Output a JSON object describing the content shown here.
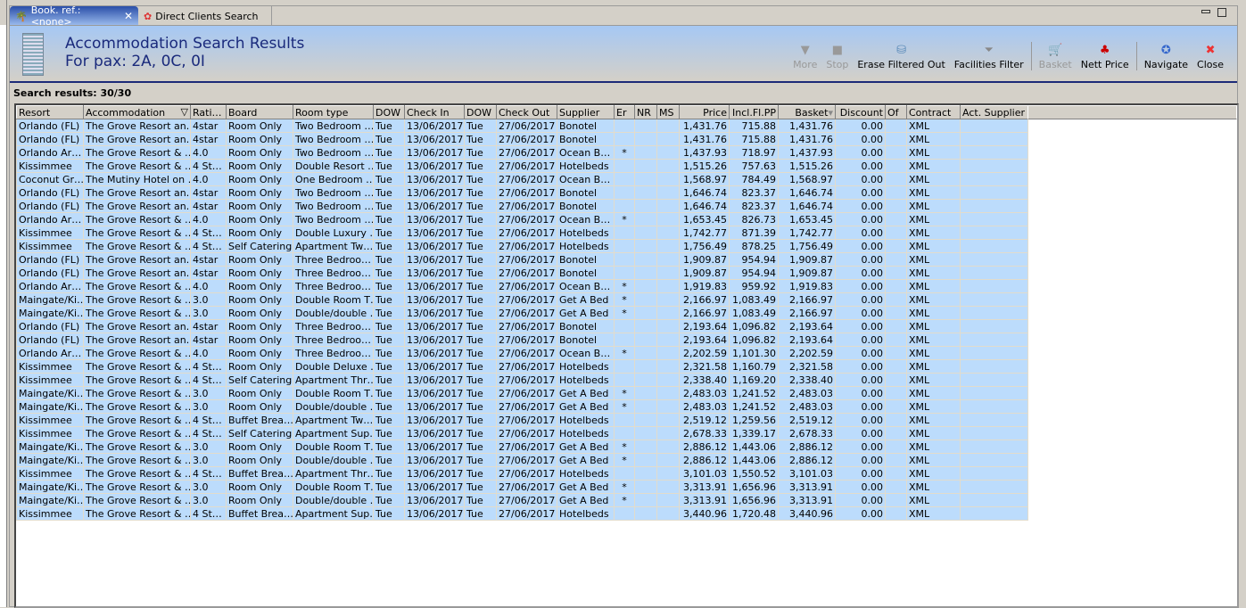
{
  "tabs": [
    {
      "label": "Book. ref.: <none>",
      "icon": "palm-island-icon",
      "active": true
    },
    {
      "label": "Direct Clients Search",
      "icon": "client-icon",
      "active": false
    }
  ],
  "header": {
    "title": "Accommodation Search Results",
    "subtitle": "For pax: 2A, 0C, 0I"
  },
  "toolbar": [
    {
      "label": "More",
      "icon": "triangle-down-icon",
      "enabled": false
    },
    {
      "label": "Stop",
      "icon": "stop-icon",
      "enabled": false
    },
    {
      "label": "Erase Filtered Out",
      "icon": "erase-bin-icon",
      "enabled": true
    },
    {
      "label": "Facilities Filter",
      "icon": "funnel-icon",
      "enabled": true
    },
    {
      "label": "Basket",
      "icon": "cart-icon",
      "enabled": false
    },
    {
      "label": "Nett Price",
      "icon": "nett-price-icon",
      "enabled": true
    },
    {
      "label": "Navigate",
      "icon": "compass-icon",
      "enabled": true
    },
    {
      "label": "Close",
      "icon": "close-icon",
      "enabled": true
    }
  ],
  "results_label": "Search results: 30/30",
  "columns": [
    "Resort",
    "Accommodation",
    "Rati…",
    "Board",
    "Room type",
    "DOW",
    "Check In",
    "DOW",
    "Check Out",
    "Supplier",
    "Er",
    "NR",
    "MS",
    "Price",
    "Incl.Fl.PP",
    "Basket",
    "Discount",
    "Of",
    "Contract",
    "Act. Supplier"
  ],
  "rows": [
    [
      "Orlando (FL)",
      "The Grove Resort an…",
      "4star",
      "Room Only",
      "Two Bedroom …",
      "Tue",
      "13/06/2017",
      "Tue",
      "27/06/2017",
      "Bonotel",
      "",
      "",
      "",
      "1,431.76",
      "715.88",
      "1,431.76",
      "0.00",
      "",
      "XML",
      ""
    ],
    [
      "Orlando (FL)",
      "The Grove Resort an…",
      "4star",
      "Room Only",
      "Two Bedroom …",
      "Tue",
      "13/06/2017",
      "Tue",
      "27/06/2017",
      "Bonotel",
      "",
      "",
      "",
      "1,431.76",
      "715.88",
      "1,431.76",
      "0.00",
      "",
      "XML",
      ""
    ],
    [
      "Orlando Ar…",
      "The Grove Resort & …",
      "4.0",
      "Room Only",
      "Two Bedroom …",
      "Tue",
      "13/06/2017",
      "Tue",
      "27/06/2017",
      "Ocean B…",
      "*",
      "",
      "",
      "1,437.93",
      "718.97",
      "1,437.93",
      "0.00",
      "",
      "XML",
      ""
    ],
    [
      "Kissimmee",
      "The Grove Resort & …",
      "4 St…",
      "Room Only",
      "Double Resort …",
      "Tue",
      "13/06/2017",
      "Tue",
      "27/06/2017",
      "Hotelbeds",
      "",
      "",
      "",
      "1,515.26",
      "757.63",
      "1,515.26",
      "0.00",
      "",
      "XML",
      ""
    ],
    [
      "Coconut Gr…",
      "The Mutiny Hotel on …",
      "4.0",
      "Room Only",
      "One Bedroom …",
      "Tue",
      "13/06/2017",
      "Tue",
      "27/06/2017",
      "Ocean B…",
      "",
      "",
      "",
      "1,568.97",
      "784.49",
      "1,568.97",
      "0.00",
      "",
      "XML",
      ""
    ],
    [
      "Orlando (FL)",
      "The Grove Resort an…",
      "4star",
      "Room Only",
      "Two Bedroom …",
      "Tue",
      "13/06/2017",
      "Tue",
      "27/06/2017",
      "Bonotel",
      "",
      "",
      "",
      "1,646.74",
      "823.37",
      "1,646.74",
      "0.00",
      "",
      "XML",
      ""
    ],
    [
      "Orlando (FL)",
      "The Grove Resort an…",
      "4star",
      "Room Only",
      "Two Bedroom …",
      "Tue",
      "13/06/2017",
      "Tue",
      "27/06/2017",
      "Bonotel",
      "",
      "",
      "",
      "1,646.74",
      "823.37",
      "1,646.74",
      "0.00",
      "",
      "XML",
      ""
    ],
    [
      "Orlando Ar…",
      "The Grove Resort & …",
      "4.0",
      "Room Only",
      "Two Bedroom …",
      "Tue",
      "13/06/2017",
      "Tue",
      "27/06/2017",
      "Ocean B…",
      "*",
      "",
      "",
      "1,653.45",
      "826.73",
      "1,653.45",
      "0.00",
      "",
      "XML",
      ""
    ],
    [
      "Kissimmee",
      "The Grove Resort & …",
      "4 St…",
      "Room Only",
      "Double Luxury …",
      "Tue",
      "13/06/2017",
      "Tue",
      "27/06/2017",
      "Hotelbeds",
      "",
      "",
      "",
      "1,742.77",
      "871.39",
      "1,742.77",
      "0.00",
      "",
      "XML",
      ""
    ],
    [
      "Kissimmee",
      "The Grove Resort & …",
      "4 St…",
      "Self Catering",
      "Apartment Tw…",
      "Tue",
      "13/06/2017",
      "Tue",
      "27/06/2017",
      "Hotelbeds",
      "",
      "",
      "",
      "1,756.49",
      "878.25",
      "1,756.49",
      "0.00",
      "",
      "XML",
      ""
    ],
    [
      "Orlando (FL)",
      "The Grove Resort an…",
      "4star",
      "Room Only",
      "Three Bedroo…",
      "Tue",
      "13/06/2017",
      "Tue",
      "27/06/2017",
      "Bonotel",
      "",
      "",
      "",
      "1,909.87",
      "954.94",
      "1,909.87",
      "0.00",
      "",
      "XML",
      ""
    ],
    [
      "Orlando (FL)",
      "The Grove Resort an…",
      "4star",
      "Room Only",
      "Three Bedroo…",
      "Tue",
      "13/06/2017",
      "Tue",
      "27/06/2017",
      "Bonotel",
      "",
      "",
      "",
      "1,909.87",
      "954.94",
      "1,909.87",
      "0.00",
      "",
      "XML",
      ""
    ],
    [
      "Orlando Ar…",
      "The Grove Resort & …",
      "4.0",
      "Room Only",
      "Three Bedroo…",
      "Tue",
      "13/06/2017",
      "Tue",
      "27/06/2017",
      "Ocean B…",
      "*",
      "",
      "",
      "1,919.83",
      "959.92",
      "1,919.83",
      "0.00",
      "",
      "XML",
      ""
    ],
    [
      "Maingate/Ki…",
      "The Grove Resort & …",
      "3.0",
      "Room Only",
      "Double Room T…",
      "Tue",
      "13/06/2017",
      "Tue",
      "27/06/2017",
      "Get A Bed",
      "*",
      "",
      "",
      "2,166.97",
      "1,083.49",
      "2,166.97",
      "0.00",
      "",
      "XML",
      ""
    ],
    [
      "Maingate/Ki…",
      "The Grove Resort & …",
      "3.0",
      "Room Only",
      "Double/double …",
      "Tue",
      "13/06/2017",
      "Tue",
      "27/06/2017",
      "Get A Bed",
      "*",
      "",
      "",
      "2,166.97",
      "1,083.49",
      "2,166.97",
      "0.00",
      "",
      "XML",
      ""
    ],
    [
      "Orlando (FL)",
      "The Grove Resort an…",
      "4star",
      "Room Only",
      "Three Bedroo…",
      "Tue",
      "13/06/2017",
      "Tue",
      "27/06/2017",
      "Bonotel",
      "",
      "",
      "",
      "2,193.64",
      "1,096.82",
      "2,193.64",
      "0.00",
      "",
      "XML",
      ""
    ],
    [
      "Orlando (FL)",
      "The Grove Resort an…",
      "4star",
      "Room Only",
      "Three Bedroo…",
      "Tue",
      "13/06/2017",
      "Tue",
      "27/06/2017",
      "Bonotel",
      "",
      "",
      "",
      "2,193.64",
      "1,096.82",
      "2,193.64",
      "0.00",
      "",
      "XML",
      ""
    ],
    [
      "Orlando Ar…",
      "The Grove Resort & …",
      "4.0",
      "Room Only",
      "Three Bedroo…",
      "Tue",
      "13/06/2017",
      "Tue",
      "27/06/2017",
      "Ocean B…",
      "*",
      "",
      "",
      "2,202.59",
      "1,101.30",
      "2,202.59",
      "0.00",
      "",
      "XML",
      ""
    ],
    [
      "Kissimmee",
      "The Grove Resort & …",
      "4 St…",
      "Room Only",
      "Double Deluxe …",
      "Tue",
      "13/06/2017",
      "Tue",
      "27/06/2017",
      "Hotelbeds",
      "",
      "",
      "",
      "2,321.58",
      "1,160.79",
      "2,321.58",
      "0.00",
      "",
      "XML",
      ""
    ],
    [
      "Kissimmee",
      "The Grove Resort & …",
      "4 St…",
      "Self Catering",
      "Apartment Thr…",
      "Tue",
      "13/06/2017",
      "Tue",
      "27/06/2017",
      "Hotelbeds",
      "",
      "",
      "",
      "2,338.40",
      "1,169.20",
      "2,338.40",
      "0.00",
      "",
      "XML",
      ""
    ],
    [
      "Maingate/Ki…",
      "The Grove Resort & …",
      "3.0",
      "Room Only",
      "Double Room T…",
      "Tue",
      "13/06/2017",
      "Tue",
      "27/06/2017",
      "Get A Bed",
      "*",
      "",
      "",
      "2,483.03",
      "1,241.52",
      "2,483.03",
      "0.00",
      "",
      "XML",
      ""
    ],
    [
      "Maingate/Ki…",
      "The Grove Resort & …",
      "3.0",
      "Room Only",
      "Double/double …",
      "Tue",
      "13/06/2017",
      "Tue",
      "27/06/2017",
      "Get A Bed",
      "*",
      "",
      "",
      "2,483.03",
      "1,241.52",
      "2,483.03",
      "0.00",
      "",
      "XML",
      ""
    ],
    [
      "Kissimmee",
      "The Grove Resort & …",
      "4 St…",
      "Buffet Brea…",
      "Apartment Tw…",
      "Tue",
      "13/06/2017",
      "Tue",
      "27/06/2017",
      "Hotelbeds",
      "",
      "",
      "",
      "2,519.12",
      "1,259.56",
      "2,519.12",
      "0.00",
      "",
      "XML",
      ""
    ],
    [
      "Kissimmee",
      "The Grove Resort & …",
      "4 St…",
      "Self Catering",
      "Apartment Sup…",
      "Tue",
      "13/06/2017",
      "Tue",
      "27/06/2017",
      "Hotelbeds",
      "",
      "",
      "",
      "2,678.33",
      "1,339.17",
      "2,678.33",
      "0.00",
      "",
      "XML",
      ""
    ],
    [
      "Maingate/Ki…",
      "The Grove Resort & …",
      "3.0",
      "Room Only",
      "Double Room T…",
      "Tue",
      "13/06/2017",
      "Tue",
      "27/06/2017",
      "Get A Bed",
      "*",
      "",
      "",
      "2,886.12",
      "1,443.06",
      "2,886.12",
      "0.00",
      "",
      "XML",
      ""
    ],
    [
      "Maingate/Ki…",
      "The Grove Resort & …",
      "3.0",
      "Room Only",
      "Double/double …",
      "Tue",
      "13/06/2017",
      "Tue",
      "27/06/2017",
      "Get A Bed",
      "*",
      "",
      "",
      "2,886.12",
      "1,443.06",
      "2,886.12",
      "0.00",
      "",
      "XML",
      ""
    ],
    [
      "Kissimmee",
      "The Grove Resort & …",
      "4 St…",
      "Buffet Brea…",
      "Apartment Thr…",
      "Tue",
      "13/06/2017",
      "Tue",
      "27/06/2017",
      "Hotelbeds",
      "",
      "",
      "",
      "3,101.03",
      "1,550.52",
      "3,101.03",
      "0.00",
      "",
      "XML",
      ""
    ],
    [
      "Maingate/Ki…",
      "The Grove Resort & …",
      "3.0",
      "Room Only",
      "Double Room T…",
      "Tue",
      "13/06/2017",
      "Tue",
      "27/06/2017",
      "Get A Bed",
      "*",
      "",
      "",
      "3,313.91",
      "1,656.96",
      "3,313.91",
      "0.00",
      "",
      "XML",
      ""
    ],
    [
      "Maingate/Ki…",
      "The Grove Resort & …",
      "3.0",
      "Room Only",
      "Double/double …",
      "Tue",
      "13/06/2017",
      "Tue",
      "27/06/2017",
      "Get A Bed",
      "*",
      "",
      "",
      "3,313.91",
      "1,656.96",
      "3,313.91",
      "0.00",
      "",
      "XML",
      ""
    ],
    [
      "Kissimmee",
      "The Grove Resort & …",
      "4 St…",
      "Buffet Brea…",
      "Apartment Sup…",
      "Tue",
      "13/06/2017",
      "Tue",
      "27/06/2017",
      "Hotelbeds",
      "",
      "",
      "",
      "3,440.96",
      "1,720.48",
      "3,440.96",
      "0.00",
      "",
      "XML",
      ""
    ]
  ],
  "colors": {
    "row_bg": "#bcdcfc",
    "title": "#1a2a7c",
    "header_rule": "#1c2a78"
  }
}
